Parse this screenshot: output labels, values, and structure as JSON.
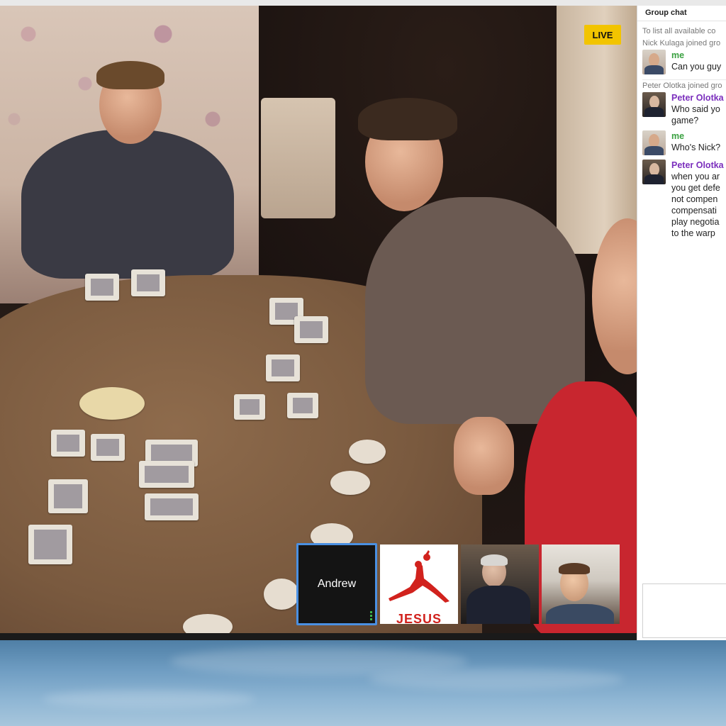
{
  "video": {
    "live_badge": "LIVE"
  },
  "participants": [
    {
      "name": "Andrew",
      "selected": true
    },
    {
      "name": "",
      "logo_text": "JESUS"
    },
    {
      "name": ""
    },
    {
      "name": ""
    }
  ],
  "chat": {
    "title": "Group chat",
    "system_intro": "To list all available co",
    "entries": [
      {
        "type": "system",
        "text": "Nick Kulaga joined gro"
      },
      {
        "type": "message",
        "author": "me",
        "lines": [
          "Can you guy"
        ]
      },
      {
        "type": "system",
        "text": "Peter Olotka joined gro"
      },
      {
        "type": "message",
        "author": "Peter Olotka",
        "lines": [
          "Who said yo",
          "game?"
        ]
      },
      {
        "type": "message",
        "author": "me",
        "lines": [
          "Who's Nick?"
        ]
      },
      {
        "type": "message",
        "author": "Peter Olotka",
        "lines": [
          "when you ar",
          "you get defe",
          "not compen",
          "compensati",
          "play negotia",
          "to the warp"
        ]
      }
    ]
  },
  "colors": {
    "live": "#f2c400",
    "selected_border": "#4a90e2",
    "me": "#3aa141",
    "peter": "#7b2fbd"
  }
}
